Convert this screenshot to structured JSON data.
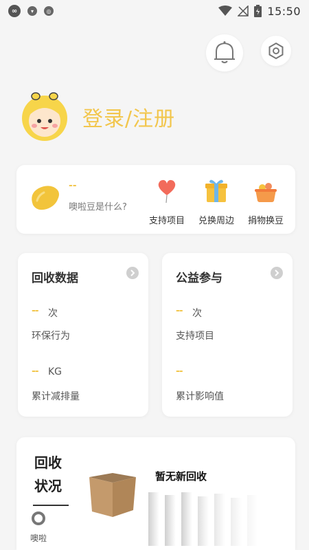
{
  "status_bar": {
    "time": "15:50",
    "left_icons": [
      "link-icon",
      "shield-icon",
      "chrome-icon"
    ],
    "right_icons": [
      "wifi-icon",
      "no-signal-icon",
      "battery-icon"
    ]
  },
  "header": {
    "bell_icon": "bell-icon",
    "settings_icon": "gear-icon"
  },
  "profile": {
    "login_label": "登录/注册"
  },
  "beans": {
    "value": "--",
    "question": "噢啦豆是什么?",
    "actions": [
      {
        "label": "支持项目",
        "icon": "balloon-heart-icon"
      },
      {
        "label": "兑换周边",
        "icon": "gift-box-icon"
      },
      {
        "label": "捐物换豆",
        "icon": "basket-icon"
      }
    ]
  },
  "recycle_data": {
    "title": "回收数据",
    "metric1": {
      "value": "--",
      "unit": "次",
      "caption": "环保行为"
    },
    "metric2": {
      "value": "--",
      "unit": "KG",
      "caption": "累计减排量"
    }
  },
  "charity": {
    "title": "公益参与",
    "metric1": {
      "value": "--",
      "unit": "次",
      "caption": "支持项目"
    },
    "metric2": {
      "value": "--",
      "unit": "",
      "caption": "累计影响值"
    }
  },
  "recycle_status": {
    "title": "回收状况",
    "empty_text": "暂无新回收"
  },
  "bottom_nav": {
    "home_label": "噢啦"
  },
  "colors": {
    "accent": "#f2c64d",
    "background": "#f5f5f5"
  }
}
